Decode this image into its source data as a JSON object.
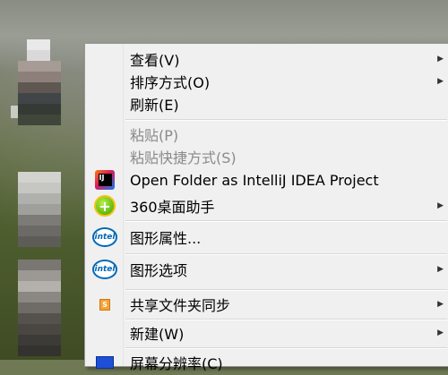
{
  "context_menu": {
    "items": [
      {
        "label": "查看(V)",
        "has_submenu": true,
        "enabled": true,
        "icon": ""
      },
      {
        "label": "排序方式(O)",
        "has_submenu": true,
        "enabled": true,
        "icon": ""
      },
      {
        "label": "刷新(E)",
        "has_submenu": false,
        "enabled": true,
        "icon": ""
      },
      {
        "label": "粘贴(P)",
        "has_submenu": false,
        "enabled": false,
        "icon": ""
      },
      {
        "label": "粘贴快捷方式(S)",
        "has_submenu": false,
        "enabled": false,
        "icon": ""
      },
      {
        "label": "Open Folder as IntelliJ IDEA Project",
        "has_submenu": false,
        "enabled": true,
        "icon": "intellij-idea-icon"
      },
      {
        "label": "360桌面助手",
        "has_submenu": true,
        "enabled": true,
        "icon": "360-plus-icon"
      },
      {
        "label": "图形属性...",
        "has_submenu": false,
        "enabled": true,
        "icon": "intel-graphics-icon"
      },
      {
        "label": "图形选项",
        "has_submenu": true,
        "enabled": true,
        "icon": "intel-graphics-icon"
      },
      {
        "label": "共享文件夹同步",
        "has_submenu": true,
        "enabled": true,
        "icon": "sync-icon"
      },
      {
        "label": "新建(W)",
        "has_submenu": true,
        "enabled": true,
        "icon": ""
      },
      {
        "label": "屏幕分辨率(C)",
        "has_submenu": false,
        "enabled": true,
        "icon": "screen-icon"
      }
    ],
    "submenu_arrow": "▶",
    "intel_logo_text": "intel",
    "idea_logo_text": "IJ",
    "icon_360_text": "+",
    "sync_icon_text": "S"
  },
  "colors": {
    "menu_background": "#f0f0f0",
    "disabled_text": "#8a8a8a",
    "intel_blue": "#0068b5"
  }
}
